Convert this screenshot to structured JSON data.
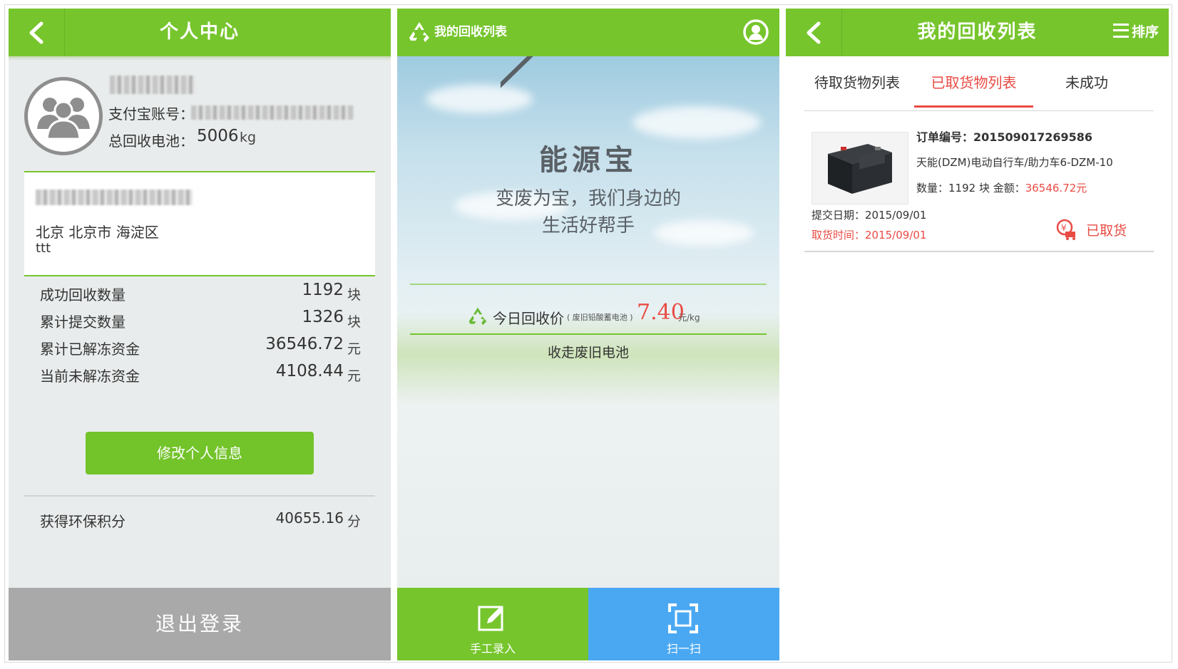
{
  "panel1": {
    "title": "个人中心",
    "alipay_label": "支付宝账号：",
    "total_label": "总回收电池：",
    "total_value": "5006",
    "total_unit": "kg",
    "address": "北京 北京市 海淀区",
    "address_detail": "ttt",
    "stats": [
      {
        "label": "成功回收数量",
        "value": "1192",
        "unit": "块"
      },
      {
        "label": "累计提交数量",
        "value": "1326",
        "unit": "块"
      },
      {
        "label": "累计已解冻资金",
        "value": "36546.72",
        "unit": "元"
      },
      {
        "label": "当前未解冻资金",
        "value": "4108.44",
        "unit": "元"
      }
    ],
    "edit_button": "修改个人信息",
    "points_label": "获得环保积分",
    "points_value": "40655.16",
    "points_unit": "分",
    "logout_button": "退出登录"
  },
  "panel2": {
    "title": "我的回收列表",
    "brand": "能源宝",
    "slogan_line1": "变废为宝，我们身边的",
    "slogan_line2": "生活好帮手",
    "price_label": "今日回收价",
    "price_note": "( 废旧铅酸蓄电池 )",
    "price_value": "7.40",
    "price_unit": "元/kg",
    "collect_text": "收走废旧电池",
    "manual_button": "手工录入",
    "scan_button": "扫一扫",
    "colors": {
      "green": "#76c52d",
      "blue": "#4aa8f2",
      "price": "#e94b44"
    }
  },
  "panel3": {
    "title": "我的回收列表",
    "sort_button": "排序",
    "tabs": [
      "待取货物列表",
      "已取货物列表",
      "未成功"
    ],
    "active_tab": "已取货物列表",
    "order": {
      "number_label": "订单编号：",
      "number": "201509017269586",
      "product": "天能(DZM)电动自行车/助力车6-DZM-10",
      "qty_amount_label": "数量：1192 块 金额：",
      "amount": "36546.72元",
      "submit_date": "提交日期：2015/09/01",
      "pickup_time": "取货时间：2015/09/01",
      "status": "已取货"
    }
  }
}
